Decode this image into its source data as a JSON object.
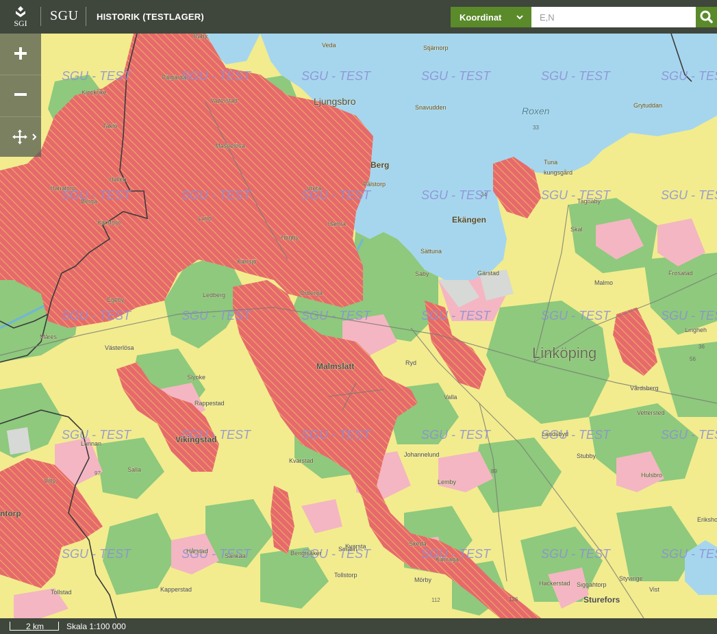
{
  "header": {
    "logo_seal_text": "SGI",
    "logo_text": "SGU",
    "title": "HISTORIK (TESTLAGER)",
    "coord_select_label": "Koordinat",
    "search_placeholder": "E,N"
  },
  "map": {
    "watermark": "SGU - TEST",
    "colors": {
      "base_yellow": "#f2ec8e",
      "green": "#8ec97d",
      "pink": "#f4b6c2",
      "red": "#e66a6c",
      "water": "#a6d6ee",
      "gray": "#d7d9d6",
      "boundary": "#3a3a3a",
      "hatch": "#f3d25e"
    },
    "place_labels": [
      {
        "name": "Ljungsbro",
        "style": "town"
      },
      {
        "name": "Roxen",
        "style": "water"
      },
      {
        "name": "Stjärnorp",
        "style": "small"
      },
      {
        "name": "Snavudden",
        "style": "small"
      },
      {
        "name": "Grytuddan",
        "style": "small"
      },
      {
        "name": "Berg",
        "style": "village"
      },
      {
        "name": "Pålstorp",
        "style": "small"
      },
      {
        "name": "Tuna",
        "style": "small"
      },
      {
        "name": "kungsgård",
        "style": "small"
      },
      {
        "name": "Ekängen",
        "style": "village"
      },
      {
        "name": "Sättuna",
        "style": "small"
      },
      {
        "name": "Saby",
        "style": "small"
      },
      {
        "name": "Gärstad",
        "style": "small"
      },
      {
        "name": "Tagnaby",
        "style": "small"
      },
      {
        "name": "Skäl",
        "style": "small"
      },
      {
        "name": "Malmo",
        "style": "small"
      },
      {
        "name": "Frösätad",
        "style": "small"
      },
      {
        "name": "Linköping",
        "style": "city"
      },
      {
        "name": "Lingheh",
        "style": "small"
      },
      {
        "name": "Vårdsberg",
        "style": "small"
      },
      {
        "name": "Vettersted",
        "style": "small"
      },
      {
        "name": "Malmslätt",
        "style": "village"
      },
      {
        "name": "Ryd",
        "style": "small"
      },
      {
        "name": "Valla",
        "style": "small"
      },
      {
        "name": "Orberga",
        "style": "small"
      },
      {
        "name": "Ledberg",
        "style": "small"
      },
      {
        "name": "Kärrsjö",
        "style": "small"
      },
      {
        "name": "Vreta",
        "style": "small"
      },
      {
        "name": "Hamra",
        "style": "small"
      },
      {
        "name": "Högby",
        "style": "small"
      },
      {
        "name": "Lund",
        "style": "small"
      },
      {
        "name": "Maspelösa",
        "style": "small"
      },
      {
        "name": "Vazerstad",
        "style": "small"
      },
      {
        "name": "Pålgårda",
        "style": "small"
      },
      {
        "name": "Raby",
        "style": "small"
      },
      {
        "name": "Veda",
        "style": "small"
      },
      {
        "name": "Klockrike",
        "style": "small"
      },
      {
        "name": "Taktö",
        "style": "small"
      },
      {
        "name": "Hallen",
        "style": "small"
      },
      {
        "name": "Hanatorp",
        "style": "small"
      },
      {
        "name": "Berga",
        "style": "small"
      },
      {
        "name": "Karstorp",
        "style": "small"
      },
      {
        "name": "Egeby",
        "style": "small"
      },
      {
        "name": "Måres",
        "style": "small"
      },
      {
        "name": "Västerlösa",
        "style": "small"
      },
      {
        "name": "Slyoke",
        "style": "small"
      },
      {
        "name": "Rappestad",
        "style": "small"
      },
      {
        "name": "Vikingstad",
        "style": "village"
      },
      {
        "name": "Kvarstad",
        "style": "small"
      },
      {
        "name": "Lunnan",
        "style": "small"
      },
      {
        "name": "Sälla",
        "style": "small"
      },
      {
        "name": "Viby",
        "style": "small"
      },
      {
        "name": "ntorp",
        "style": "village"
      },
      {
        "name": "Tollstad",
        "style": "small"
      },
      {
        "name": "Kapperstad",
        "style": "small"
      },
      {
        "name": "Hårstad",
        "style": "small"
      },
      {
        "name": "Sankaa",
        "style": "small"
      },
      {
        "name": "Bengtsåker",
        "style": "small"
      },
      {
        "name": "Smålin",
        "style": "small"
      },
      {
        "name": "Kvarsta",
        "style": "small"
      },
      {
        "name": "Skeda",
        "style": "small"
      },
      {
        "name": "Kärnaga",
        "style": "small"
      },
      {
        "name": "Tollstorp",
        "style": "small"
      },
      {
        "name": "Mörby",
        "style": "small"
      },
      {
        "name": "Häckerstad",
        "style": "small"
      },
      {
        "name": "Siggahtorp",
        "style": "small"
      },
      {
        "name": "Styvinge",
        "style": "small"
      },
      {
        "name": "Vist",
        "style": "small"
      },
      {
        "name": "Sturefors",
        "style": "village"
      },
      {
        "name": "Eriksholm",
        "style": "small"
      },
      {
        "name": "Stubby",
        "style": "small"
      },
      {
        "name": "Hulsbro",
        "style": "small"
      },
      {
        "name": "Landsbyd",
        "style": "small"
      },
      {
        "name": "Johannelund",
        "style": "small"
      },
      {
        "name": "Lemby",
        "style": "small"
      },
      {
        "name": "Hadaga",
        "style": "small"
      }
    ],
    "road_numbers": [
      "33",
      "34",
      "89",
      "112",
      "126",
      "36",
      "97",
      "56"
    ]
  },
  "footer": {
    "scale_bar_label": "2 km",
    "scale_text": "Skala 1:100 000"
  }
}
